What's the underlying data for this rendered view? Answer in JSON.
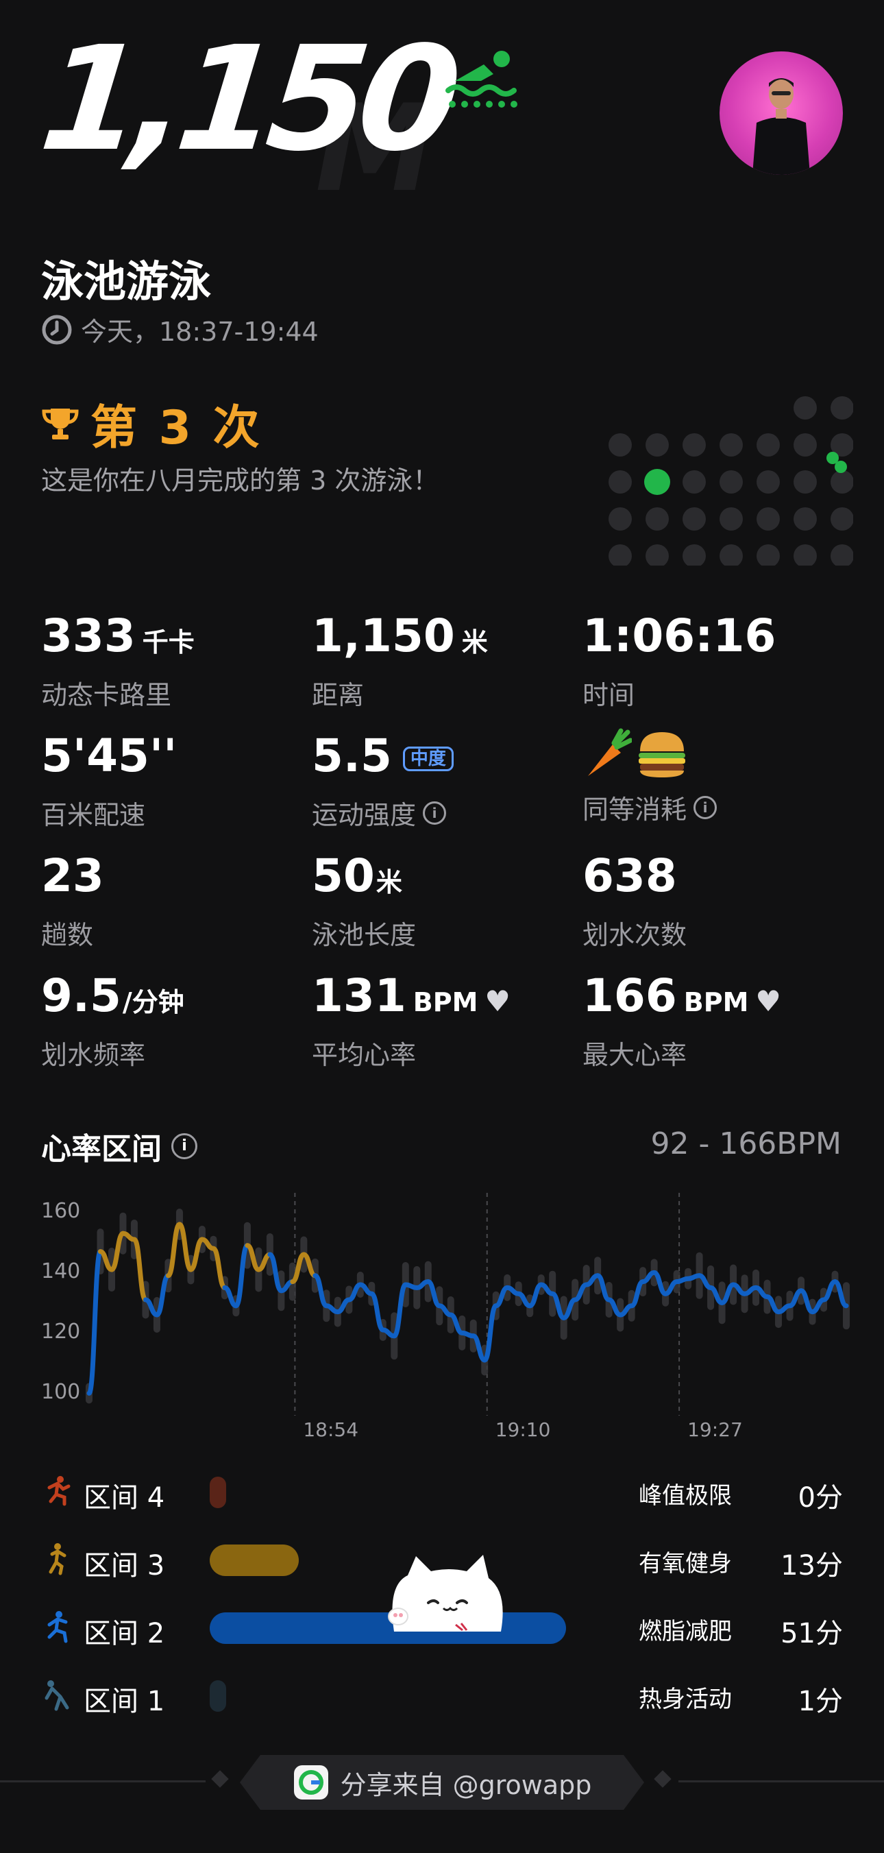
{
  "hero": {
    "distance": "1,150",
    "unit": "M"
  },
  "workout": {
    "title": "泳池游泳",
    "time": "今天，18:37-19:44"
  },
  "rank": {
    "label": "第 3 次",
    "description": "这是你在八月完成的第 3 次游泳！"
  },
  "stats": {
    "calories": {
      "value": "333",
      "unit": "千卡",
      "label": "动态卡路里"
    },
    "distance": {
      "value": "1,150",
      "unit": "米",
      "label": "距离"
    },
    "duration": {
      "value": "1:06:16",
      "label": "时间"
    },
    "pace": {
      "value": "5'45''",
      "label": "百米配速"
    },
    "intensity": {
      "value": "5.5",
      "badge": "中度",
      "label": "运动强度"
    },
    "equivalent": {
      "label": "同等消耗",
      "icons": [
        "carrot-icon",
        "burger-icon"
      ]
    },
    "laps": {
      "value": "23",
      "label": "趟数"
    },
    "pool_length": {
      "value": "50",
      "unit": "米",
      "label": "泳池长度"
    },
    "strokes": {
      "value": "638",
      "label": "划水次数"
    },
    "stroke_rate": {
      "value": "9.5",
      "unit": "/分钟",
      "label": "划水频率"
    },
    "avg_hr": {
      "value": "131",
      "unit": "BPM",
      "label": "平均心率"
    },
    "max_hr": {
      "value": "166",
      "unit": "BPM",
      "label": "最大心率"
    }
  },
  "heart_rate": {
    "title": "心率区间",
    "range": "92 - 166BPM"
  },
  "chart_data": {
    "type": "line",
    "yticks": [
      "160",
      "140",
      "120",
      "100"
    ],
    "xticks": [
      "18:54",
      "19:10",
      "19:27"
    ],
    "ylim": [
      95,
      170
    ],
    "x_minutes": [
      0,
      1,
      2,
      3,
      4,
      5,
      6,
      7,
      8,
      9,
      10,
      11,
      12,
      13,
      14,
      15,
      16,
      17,
      18,
      19,
      20,
      21,
      22,
      23,
      24,
      25,
      26,
      27,
      28,
      29,
      30,
      31,
      32,
      33,
      34,
      35,
      36,
      37,
      38,
      39,
      40,
      41,
      42,
      43,
      44,
      45,
      46,
      47,
      48,
      49,
      50,
      51,
      52,
      53,
      54,
      55,
      56,
      57,
      58,
      59,
      60,
      61,
      62,
      63,
      64,
      65,
      66,
      67
    ],
    "values": [
      99,
      146,
      140,
      152,
      150,
      130,
      125,
      138,
      155,
      140,
      150,
      147,
      134,
      128,
      148,
      140,
      145,
      133,
      136,
      145,
      138,
      128,
      126,
      130,
      135,
      132,
      120,
      118,
      135,
      134,
      136,
      128,
      125,
      119,
      118,
      110,
      128,
      134,
      132,
      128,
      135,
      132,
      124,
      130,
      135,
      138,
      130,
      125,
      128,
      136,
      139,
      132,
      136,
      137,
      138,
      134,
      129,
      135,
      132,
      134,
      131,
      126,
      128,
      133,
      126,
      130,
      136,
      128
    ],
    "sample_color_thresholds": {
      "zone3": 140,
      "zone2": 100
    }
  },
  "zones": [
    {
      "label": "区间 4",
      "name": "峰值极限",
      "minutes": "0分",
      "fraction": 0.0,
      "color": "#5a2418",
      "icon": "runner-zone4-icon"
    },
    {
      "label": "区间 3",
      "name": "有氧健身",
      "minutes": "13分",
      "fraction": 0.25,
      "color": "#8a6610",
      "icon": "runner-zone3-icon"
    },
    {
      "label": "区间 2",
      "name": "燃脂减肥",
      "minutes": "51分",
      "fraction": 1.0,
      "color": "#0b4ea2",
      "icon": "runner-zone2-icon"
    },
    {
      "label": "区间 1",
      "name": "热身活动",
      "minutes": "1分",
      "fraction": 0.02,
      "color": "#1d2a33",
      "icon": "stretch-zone1-icon"
    }
  ],
  "footer": {
    "text": "分享来自 @growapp"
  },
  "colors": {
    "accent_gold": "#f3a52b",
    "accent_green": "#22b64a",
    "zone2_blue": "#1060c4",
    "zone3_gold": "#b8861b"
  }
}
